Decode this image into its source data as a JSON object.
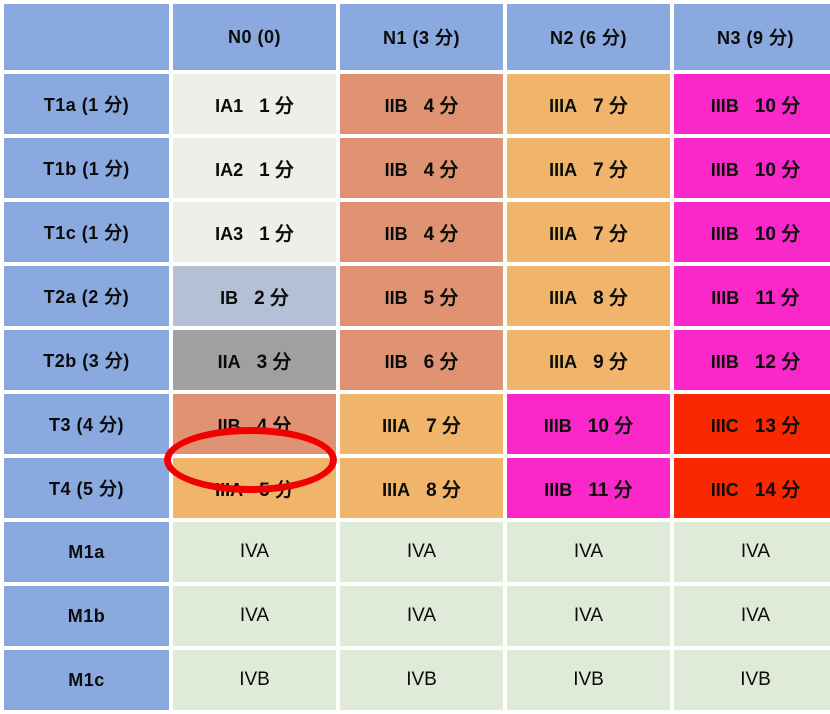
{
  "table": {
    "corner_label": "",
    "column_headers": [
      {
        "label": "N0 (0)"
      },
      {
        "label": "N1 (3 分)"
      },
      {
        "label": "N2 (6 分)"
      },
      {
        "label": "N3 (9 分)"
      }
    ],
    "rows": [
      {
        "header": "T1a (1 分)",
        "cells": [
          {
            "stage": "IA1",
            "score": "1 分",
            "color": "#edefe9"
          },
          {
            "stage": "IIB",
            "score": "4 分",
            "color": "#e09372"
          },
          {
            "stage": "IIIA",
            "score": "7 分",
            "color": "#f0b56a"
          },
          {
            "stage": "IIIB",
            "score": "10 分",
            "color": "#fa28c8"
          }
        ]
      },
      {
        "header": "T1b (1 分)",
        "cells": [
          {
            "stage": "IA2",
            "score": "1 分",
            "color": "#edefe9"
          },
          {
            "stage": "IIB",
            "score": "4 分",
            "color": "#e09372"
          },
          {
            "stage": "IIIA",
            "score": "7 分",
            "color": "#f0b56a"
          },
          {
            "stage": "IIIB",
            "score": "10 分",
            "color": "#fa28c8"
          }
        ]
      },
      {
        "header": "T1c (1 分)",
        "cells": [
          {
            "stage": "IA3",
            "score": "1 分",
            "color": "#edefe9"
          },
          {
            "stage": "IIB",
            "score": "4 分",
            "color": "#e09372"
          },
          {
            "stage": "IIIA",
            "score": "7 分",
            "color": "#f0b56a"
          },
          {
            "stage": "IIIB",
            "score": "10 分",
            "color": "#fa28c8"
          }
        ]
      },
      {
        "header": "T2a (2 分)",
        "cells": [
          {
            "stage": "IB",
            "score": "2 分",
            "color": "#b4c0d6"
          },
          {
            "stage": "IIB",
            "score": "5 分",
            "color": "#e09372"
          },
          {
            "stage": "IIIA",
            "score": "8 分",
            "color": "#f0b56a"
          },
          {
            "stage": "IIIB",
            "score": "11 分",
            "color": "#fa28c8"
          }
        ]
      },
      {
        "header": "T2b (3 分)",
        "cells": [
          {
            "stage": "IIA",
            "score": "3 分",
            "color": "#a0a0a0"
          },
          {
            "stage": "IIB",
            "score": "6 分",
            "color": "#e09372"
          },
          {
            "stage": "IIIA",
            "score": "9 分",
            "color": "#f0b56a"
          },
          {
            "stage": "IIIB",
            "score": "12 分",
            "color": "#fa28c8"
          }
        ]
      },
      {
        "header": "T3 (4 分)",
        "cells": [
          {
            "stage": "IIB",
            "score": "4 分",
            "color": "#e09372"
          },
          {
            "stage": "IIIA",
            "score": "7 分",
            "color": "#f0b56a"
          },
          {
            "stage": "IIIB",
            "score": "10 分",
            "color": "#fa28c8"
          },
          {
            "stage": "IIIC",
            "score": "13 分",
            "color": "#fa2800"
          }
        ]
      },
      {
        "header": "T4 (5 分)",
        "cells": [
          {
            "stage": "IIIA",
            "score": "5 分",
            "color": "#f0b56a",
            "highlighted": true
          },
          {
            "stage": "IIIA",
            "score": "8 分",
            "color": "#f0b56a"
          },
          {
            "stage": "IIIB",
            "score": "11 分",
            "color": "#fa28c8"
          },
          {
            "stage": "IIIC",
            "score": "14 分",
            "color": "#fa2800"
          }
        ]
      },
      {
        "header": "M1a",
        "cells": [
          {
            "stage": "IVA",
            "score": "",
            "color": "#dfebd8"
          },
          {
            "stage": "IVA",
            "score": "",
            "color": "#dfebd8"
          },
          {
            "stage": "IVA",
            "score": "",
            "color": "#dfebd8"
          },
          {
            "stage": "IVA",
            "score": "",
            "color": "#dfebd8"
          }
        ]
      },
      {
        "header": "M1b",
        "cells": [
          {
            "stage": "IVA",
            "score": "",
            "color": "#dfebd8"
          },
          {
            "stage": "IVA",
            "score": "",
            "color": "#dfebd8"
          },
          {
            "stage": "IVA",
            "score": "",
            "color": "#dfebd8"
          },
          {
            "stage": "IVA",
            "score": "",
            "color": "#dfebd8"
          }
        ]
      },
      {
        "header": "M1c",
        "cells": [
          {
            "stage": "IVB",
            "score": "",
            "color": "#dfebd8"
          },
          {
            "stage": "IVB",
            "score": "",
            "color": "#dfebd8"
          },
          {
            "stage": "IVB",
            "score": "",
            "color": "#dfebd8"
          },
          {
            "stage": "IVB",
            "score": "",
            "color": "#dfebd8"
          }
        ]
      }
    ]
  },
  "annotation": {
    "highlight_color": "#f00000",
    "highlight_shape": "ellipse",
    "highlight_target": "T4 (5 分) / N0 (0) → IIIA 5 分"
  },
  "legend_colors": {
    "header_blue": "#8aa9de",
    "stage_i_white": "#edefe9",
    "stage_ib_bluegray": "#b4c0d6",
    "stage_iia_gray": "#a0a0a0",
    "stage_iib_salmon": "#e09372",
    "stage_iiia_orange": "#f0b56a",
    "stage_iiib_magenta": "#fa28c8",
    "stage_iiic_red": "#fa2800",
    "stage_iv_green": "#dfebd8"
  }
}
